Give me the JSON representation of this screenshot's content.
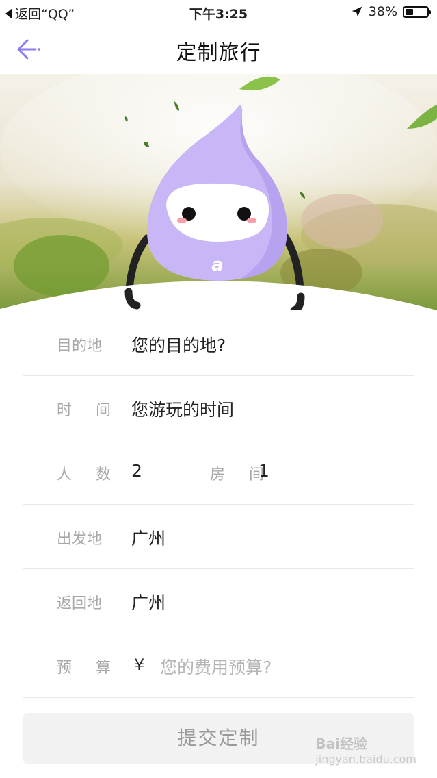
{
  "status_bar": {
    "back_app": "返回“QQ”",
    "time": "下午3:25",
    "battery_text": "38%",
    "battery_level": 0.38
  },
  "nav": {
    "title": "定制旅行"
  },
  "form": {
    "destination": {
      "label": "目的地",
      "placeholder": "您的目的地?"
    },
    "time": {
      "label": "时 间",
      "placeholder": "您游玩的时间"
    },
    "people": {
      "label": "人 数",
      "value": "2",
      "room_label": "房 间",
      "room_value": "1"
    },
    "departure": {
      "label": "出发地",
      "value": "广州"
    },
    "return": {
      "label": "返回地",
      "value": "广州"
    },
    "budget": {
      "label": "预 算",
      "currency": "¥",
      "placeholder": "您的费用预算?"
    }
  },
  "submit_label": "提交定制",
  "watermark": {
    "brand": "Bai经验",
    "url": "jingyan.baidu.com"
  },
  "colors": {
    "accent": "#8a7bf0",
    "mascot": "#c8b6f7"
  }
}
